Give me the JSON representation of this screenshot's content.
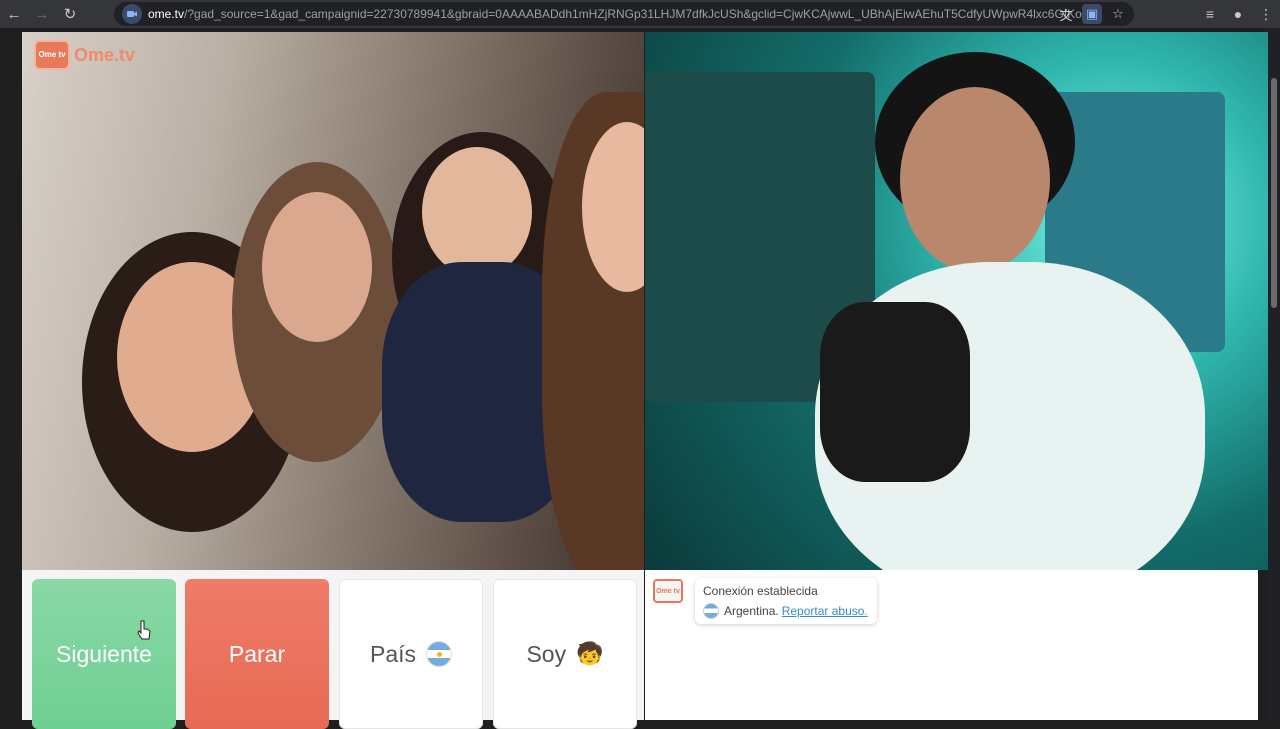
{
  "browser": {
    "url_host": "ome.tv",
    "url_rest": "/?gad_source=1&gad_campaignid=22730789941&gbraid=0AAAABADdh1mHZjRNGp31LHJM7dfkJcUSh&gclid=CjwKCAjwwL_UBhAjEiwAEhuT5CdfyUWpwR4lxc6GIKocfETtyveqhDJG94jDZ...",
    "icons": [
      "back-icon",
      "forward-icon",
      "reload-icon",
      "site-info-icon",
      "translate-icon",
      "cast-icon",
      "star-icon",
      "media-icon",
      "profile-icon",
      "menu-icon"
    ]
  },
  "brand": {
    "logo_badge": "Ome tv",
    "logo_text": "Ome.tv",
    "accent": "#e8795b"
  },
  "controls": {
    "next_label": "Siguiente",
    "stop_label": "Parar",
    "country_label": "País",
    "iam_label": "Soy",
    "iam_emoji": "🧒",
    "next_color": "#77d39a",
    "stop_color": "#ea735e"
  },
  "chat": {
    "avatar_badge": "Ome tv",
    "status": "Conexión establecida",
    "country": "Argentina.",
    "report_link": "Reportar abuso."
  }
}
